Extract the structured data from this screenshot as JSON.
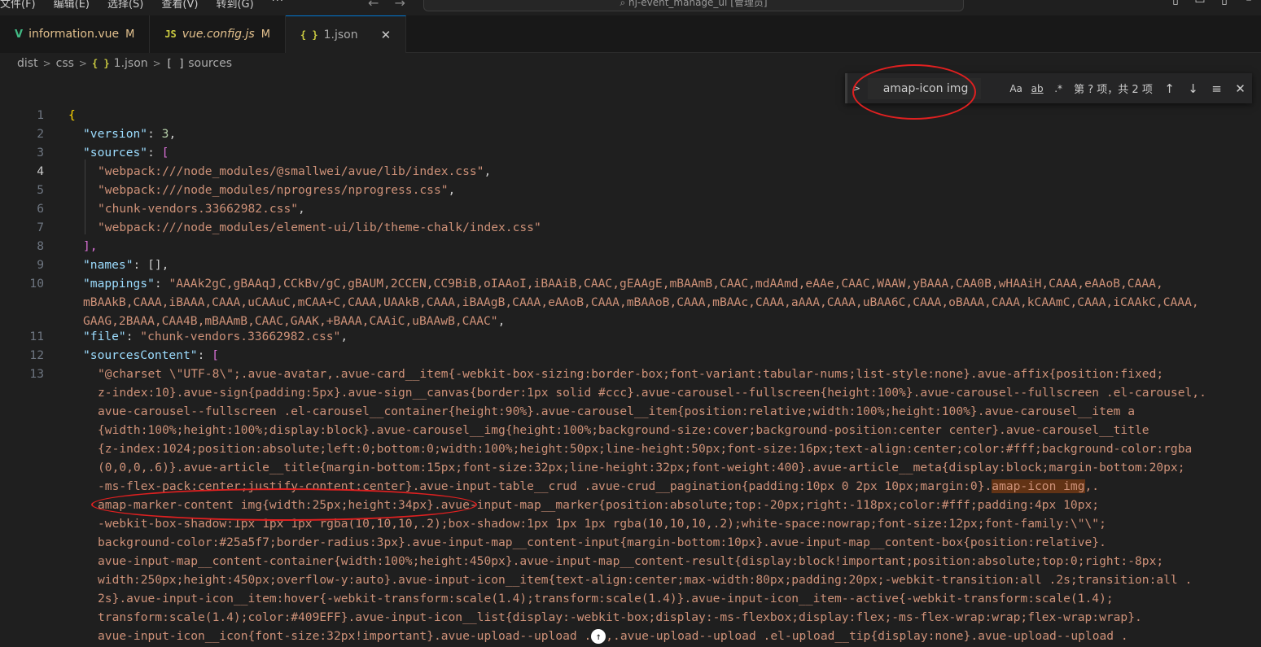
{
  "menu": {
    "items": [
      "文件(F)",
      "编辑(E)",
      "选择(S)",
      "查看(V)",
      "转到(G)"
    ],
    "more": "···"
  },
  "command_center": {
    "text": "nj-event_manage_ui [管理员]",
    "icon": "search-icon"
  },
  "tabs": [
    {
      "name": "information.vue",
      "icon": "V",
      "status": "M"
    },
    {
      "name": "vue.config.js",
      "icon": "JS",
      "status": "M"
    },
    {
      "name": "1.json",
      "icon": "{ }",
      "close": "✕"
    }
  ],
  "breadcrumb": {
    "parts": [
      "dist",
      "css",
      "1.json",
      "sources"
    ],
    "json_icon": "{ }",
    "array_icon": "[ ]"
  },
  "find_widget": {
    "query": "amap-icon img",
    "toggle": ">",
    "match_case": "Aa",
    "whole_word": "ab",
    "regex": ".*",
    "count": "第 ? 项，共 2 项",
    "prev": "↑",
    "next": "↓",
    "selection": "≡",
    "close": "✕"
  },
  "highlight_colors": {
    "annotation": "#e02020",
    "match": "#623315"
  },
  "editor": {
    "current_line": 4,
    "lines": [
      {
        "n": "1"
      },
      {
        "n": "2"
      },
      {
        "n": "3"
      },
      {
        "n": "4"
      },
      {
        "n": "5"
      },
      {
        "n": "6"
      },
      {
        "n": "7"
      },
      {
        "n": "8"
      },
      {
        "n": "9"
      },
      {
        "n": "10"
      },
      {
        "n": ""
      },
      {
        "n": "11"
      },
      {
        "n": "12"
      },
      {
        "n": "13"
      }
    ],
    "t": {
      "l1_open": "{",
      "l2_key": "\"version\"",
      "l2_colon": ": ",
      "l2_val": "3",
      "comma": ",",
      "l3_key": "\"sources\"",
      "l3_colon": ": ",
      "l3_bracket": "[",
      "l4": "\"webpack:///node_modules/@smallwei/avue/lib/index.css\"",
      "l5": "\"webpack:///node_modules/nprogress/nprogress.css\"",
      "l6": "\"chunk-vendors.33662982.css\"",
      "l7": "\"webpack:///node_modules/element-ui/lib/theme-chalk/index.css\"",
      "l8": "],",
      "l9_key": "\"names\"",
      "l9_rest": ": [],",
      "l10_key": "\"mappings\"",
      "l10_colon": ": ",
      "l10_val_a": "\"AAAk2gC,gBAAqJ,CCkBv/gC,gBAUM,2CCEN,CC9BiB,oIAAoI,iBAAiB,CAAC,gEAAgE,mBAAmB,CAAC,mdAAmd,eAAe,CAAC,WAAW,yBAAA,CAA0B,wHAAiH,CAAA,eAAoB,CAAA,",
      "l10_val_b": "mBAAkB,CAAA,iBAAA,CAAA,uCAAuC,mCAA+C,CAAA,UAAkB,CAAA,iBAAgB,CAAA,eAAoB,CAAA,mBAAoB,CAAA,mBAAc,CAAA,aAAA,CAAA,uBAA6C,CAAA,oBAAA,CAAA,kCAAmC,CAAA,iCAAkC,CAAA,",
      "l10_val_c": "GAAG,2BAAA,CAA4B,mBAAmB,CAAC,GAAK,+BAAA,CAAiC,uBAAwB,CAAC\"",
      "l11_key": "\"file\"",
      "l11_colon": ": ",
      "l11_val": "\"chunk-vendors.33662982.css\"",
      "l12_key": "\"sourcesContent\"",
      "l12_colon": ": ",
      "l12_bracket": "[",
      "w1": "\"@charset \\\"UTF-8\\\";.avue-avatar,.avue-card__item{-webkit-box-sizing:border-box;font-variant:tabular-nums;list-style:none}.avue-affix{position:fixed;",
      "w2": "z-index:10}.avue-sign{padding:5px}.avue-sign__canvas{border:1px solid #ccc}.avue-carousel--fullscreen{height:100%}.avue-carousel--fullscreen .el-carousel,.",
      "w3": "avue-carousel--fullscreen .el-carousel__container{height:90%}.avue-carousel__item{position:relative;width:100%;height:100%}.avue-carousel__item a",
      "w4": "{width:100%;height:100%;display:block}.avue-carousel__img{height:100%;background-size:cover;background-position:center center}.avue-carousel__title",
      "w5": "{z-index:1024;position:absolute;left:0;bottom:0;width:100%;height:50px;line-height:50px;font-size:16px;text-align:center;color:#fff;background-color:rgba",
      "w6": "(0,0,0,.6)}.avue-article__title{margin-bottom:15px;font-size:32px;line-height:32px;font-weight:400}.avue-article__meta{display:block;margin-bottom:20px;",
      "w7_pre": "-ms-flex-pack:center;justify-content:center}.avue-input-table__crud .avue-crud__pagination{padding:10px 0 2px 10px;margin:0}.",
      "w7_hl": "amap-icon img",
      "w7_post": ",.",
      "w8": "amap-marker-content img{width:25px;height:34px}.avue-input-map__marker{position:absolute;top:-20px;right:-118px;color:#fff;padding:4px 10px;",
      "w9": "-webkit-box-shadow:1px 1px 1px rgba(10,10,10,.2);box-shadow:1px 1px 1px rgba(10,10,10,.2);white-space:nowrap;font-size:12px;font-family:\\\"\\\";",
      "w10": "background-color:#25a5f7;border-radius:3px}.avue-input-map__content-input{margin-bottom:10px}.avue-input-map__content-box{position:relative}.",
      "w11": "avue-input-map__content-container{width:100%;height:450px}.avue-input-map__content-result{display:block!important;position:absolute;top:0;right:-8px;",
      "w12": "width:250px;height:450px;overflow-y:auto}.avue-input-icon__item{text-align:center;max-width:80px;padding:20px;-webkit-transition:all .2s;transition:all .",
      "w13": "2s}.avue-input-icon__item:hover{-webkit-transform:scale(1.4);transform:scale(1.4)}.avue-input-icon__item--active{-webkit-transform:scale(1.4);",
      "w14": "transform:scale(1.4);color:#409EFF}.avue-input-icon__list{display:-webkit-box;display:-ms-flexbox;display:flex;-ms-flex-wrap:wrap;flex-wrap:wrap}.",
      "w15_pre": "avue-input-icon__icon{font-size:32px!important}.avue-upload--upload .",
      "w15_glyph": "↑",
      "w15_post": ",.avue-upload--upload .el-upload__tip{display:none}.avue-upload--upload ."
    }
  }
}
